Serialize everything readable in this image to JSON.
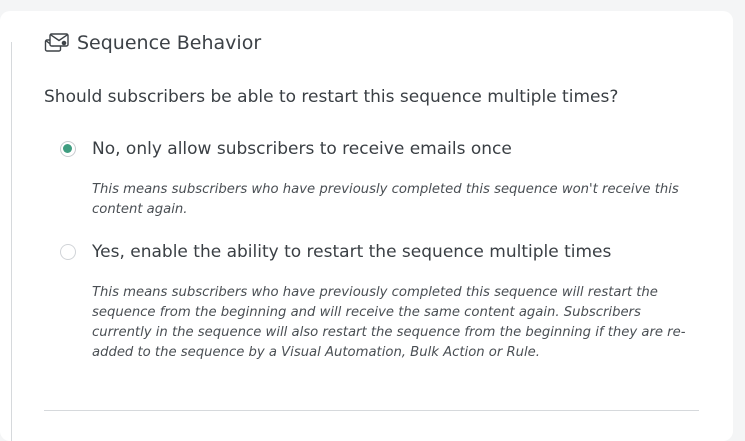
{
  "section": {
    "icon": "envelope-settings-icon",
    "title": "Sequence Behavior"
  },
  "question": "Should subscribers be able to restart this sequence multiple times?",
  "options": [
    {
      "label": "No, only allow subscribers to receive emails once",
      "selected": true,
      "description": "This means subscribers who have previously completed this sequence won't receive this content again."
    },
    {
      "label": "Yes, enable the ability to restart the sequence multiple times",
      "selected": false,
      "description": "This means subscribers who have previously completed this sequence will restart the sequence from the beginning and will receive the same content again. Subscribers currently in the sequence will also restart the sequence from the beginning if they are re-added to the sequence by a Visual Automation, Bulk Action or Rule."
    }
  ],
  "colors": {
    "accent": "#3f9d80",
    "background": "#f4f5f6",
    "card": "#ffffff",
    "text": "#3a3f44"
  }
}
